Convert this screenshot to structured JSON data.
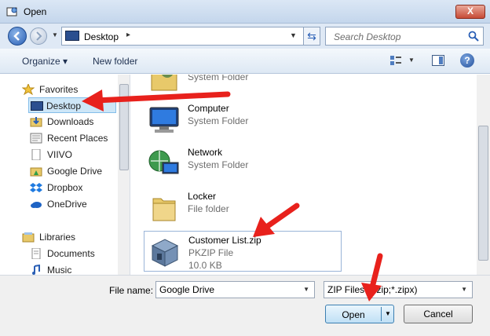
{
  "window": {
    "title": "Open",
    "close_glyph": "X"
  },
  "address_bar": {
    "location": "Desktop",
    "separator": "▸"
  },
  "search": {
    "placeholder": "Search Desktop"
  },
  "toolbar": {
    "organize": "Organize ▾",
    "new_folder": "New folder",
    "help_glyph": "?"
  },
  "nav_pane": {
    "items": [
      {
        "label": "Favorites",
        "icon": "star-icon"
      },
      {
        "label": "Desktop",
        "icon": "desktop-icon"
      },
      {
        "label": "Downloads",
        "icon": "downloads-folder-icon"
      },
      {
        "label": "Recent Places",
        "icon": "recent-places-icon"
      },
      {
        "label": "VIIVO",
        "icon": "document-icon"
      },
      {
        "label": "Google Drive",
        "icon": "google-drive-folder-icon"
      },
      {
        "label": "Dropbox",
        "icon": "dropbox-icon"
      },
      {
        "label": "OneDrive",
        "icon": "onedrive-icon"
      },
      {
        "label": "Libraries",
        "icon": "libraries-icon"
      },
      {
        "label": "Documents",
        "icon": "documents-icon"
      },
      {
        "label": "Music",
        "icon": "music-icon"
      }
    ]
  },
  "files": [
    {
      "name": "",
      "type": "System Folder",
      "icon": "user-folder-icon"
    },
    {
      "name": "Computer",
      "type": "System Folder",
      "icon": "computer-icon"
    },
    {
      "name": "Network",
      "type": "System Folder",
      "icon": "network-icon"
    },
    {
      "name": "Locker",
      "type": "File folder",
      "icon": "folder-icon"
    },
    {
      "name": "Customer List.zip",
      "type": "PKZIP File",
      "size": "10.0 KB",
      "icon": "zip-archive-icon"
    }
  ],
  "footer": {
    "file_name_label": "File name:",
    "file_name_value": "Google Drive",
    "filter": "ZIP Files (*.zip;*.zipx)",
    "open": "Open",
    "cancel": "Cancel"
  },
  "colors": {
    "annotation_arrow": "#e8211c",
    "selection": "#cde6f7"
  }
}
